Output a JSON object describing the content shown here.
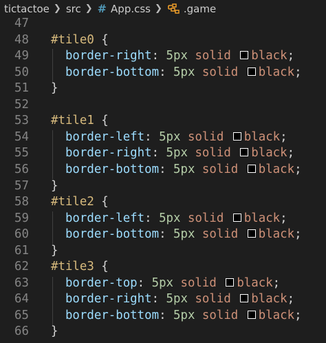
{
  "breadcrumb": {
    "folder1": "tictactoe",
    "folder2": "src",
    "file_icon": "#",
    "file": "App.css",
    "symbol": ".game"
  },
  "colors": {
    "black_swatch": "#000000"
  },
  "lines": [
    {
      "num": "47",
      "tokens": []
    },
    {
      "num": "48",
      "tokens": [
        {
          "t": "#tile0",
          "c": "sel"
        },
        {
          "t": " {",
          "c": "punc"
        }
      ]
    },
    {
      "num": "49",
      "tokens": [
        {
          "t": "  border-right",
          "c": "prop"
        },
        {
          "t": ": ",
          "c": "punc"
        },
        {
          "t": "5px",
          "c": "num"
        },
        {
          "t": " solid ",
          "c": "val"
        },
        {
          "sw": true
        },
        {
          "t": "black",
          "c": "val"
        },
        {
          "t": ";",
          "c": "punc"
        }
      ]
    },
    {
      "num": "50",
      "tokens": [
        {
          "t": "  border-bottom",
          "c": "prop"
        },
        {
          "t": ": ",
          "c": "punc"
        },
        {
          "t": "5px",
          "c": "num"
        },
        {
          "t": " solid ",
          "c": "val"
        },
        {
          "sw": true
        },
        {
          "t": "black",
          "c": "val"
        },
        {
          "t": ";",
          "c": "punc"
        }
      ]
    },
    {
      "num": "51",
      "tokens": [
        {
          "t": "}",
          "c": "punc"
        }
      ]
    },
    {
      "num": "52",
      "tokens": []
    },
    {
      "num": "53",
      "tokens": [
        {
          "t": "#tile1",
          "c": "sel"
        },
        {
          "t": " {",
          "c": "punc"
        }
      ]
    },
    {
      "num": "54",
      "tokens": [
        {
          "t": "  border-left",
          "c": "prop"
        },
        {
          "t": ": ",
          "c": "punc"
        },
        {
          "t": "5px",
          "c": "num"
        },
        {
          "t": " solid ",
          "c": "val"
        },
        {
          "sw": true
        },
        {
          "t": "black",
          "c": "val"
        },
        {
          "t": ";",
          "c": "punc"
        }
      ]
    },
    {
      "num": "55",
      "tokens": [
        {
          "t": "  border-right",
          "c": "prop"
        },
        {
          "t": ": ",
          "c": "punc"
        },
        {
          "t": "5px",
          "c": "num"
        },
        {
          "t": " solid ",
          "c": "val"
        },
        {
          "sw": true
        },
        {
          "t": "black",
          "c": "val"
        },
        {
          "t": ";",
          "c": "punc"
        }
      ]
    },
    {
      "num": "56",
      "tokens": [
        {
          "t": "  border-bottom",
          "c": "prop"
        },
        {
          "t": ": ",
          "c": "punc"
        },
        {
          "t": "5px",
          "c": "num"
        },
        {
          "t": " solid ",
          "c": "val"
        },
        {
          "sw": true
        },
        {
          "t": "black",
          "c": "val"
        },
        {
          "t": ";",
          "c": "punc"
        }
      ]
    },
    {
      "num": "57",
      "tokens": [
        {
          "t": "}",
          "c": "punc"
        }
      ]
    },
    {
      "num": "58",
      "tokens": [
        {
          "t": "#tile2",
          "c": "sel"
        },
        {
          "t": " {",
          "c": "punc"
        }
      ]
    },
    {
      "num": "59",
      "tokens": [
        {
          "t": "  border-left",
          "c": "prop"
        },
        {
          "t": ": ",
          "c": "punc"
        },
        {
          "t": "5px",
          "c": "num"
        },
        {
          "t": " solid ",
          "c": "val"
        },
        {
          "sw": true
        },
        {
          "t": "black",
          "c": "val"
        },
        {
          "t": ";",
          "c": "punc"
        }
      ]
    },
    {
      "num": "60",
      "tokens": [
        {
          "t": "  border-bottom",
          "c": "prop"
        },
        {
          "t": ": ",
          "c": "punc"
        },
        {
          "t": "5px",
          "c": "num"
        },
        {
          "t": " solid ",
          "c": "val"
        },
        {
          "sw": true
        },
        {
          "t": "black",
          "c": "val"
        },
        {
          "t": ";",
          "c": "punc"
        }
      ]
    },
    {
      "num": "61",
      "tokens": [
        {
          "t": "}",
          "c": "punc"
        }
      ]
    },
    {
      "num": "62",
      "tokens": [
        {
          "t": "#tile3",
          "c": "sel"
        },
        {
          "t": " {",
          "c": "punc"
        }
      ]
    },
    {
      "num": "63",
      "tokens": [
        {
          "t": "  border-top",
          "c": "prop"
        },
        {
          "t": ": ",
          "c": "punc"
        },
        {
          "t": "5px",
          "c": "num"
        },
        {
          "t": " solid ",
          "c": "val"
        },
        {
          "sw": true
        },
        {
          "t": "black",
          "c": "val"
        },
        {
          "t": ";",
          "c": "punc"
        }
      ]
    },
    {
      "num": "64",
      "tokens": [
        {
          "t": "  border-right",
          "c": "prop"
        },
        {
          "t": ": ",
          "c": "punc"
        },
        {
          "t": "5px",
          "c": "num"
        },
        {
          "t": " solid ",
          "c": "val"
        },
        {
          "sw": true
        },
        {
          "t": "black",
          "c": "val"
        },
        {
          "t": ";",
          "c": "punc"
        }
      ]
    },
    {
      "num": "65",
      "tokens": [
        {
          "t": "  border-bottom",
          "c": "prop"
        },
        {
          "t": ": ",
          "c": "punc"
        },
        {
          "t": "5px",
          "c": "num"
        },
        {
          "t": " solid ",
          "c": "val"
        },
        {
          "sw": true
        },
        {
          "t": "black",
          "c": "val"
        },
        {
          "t": ";",
          "c": "punc"
        }
      ]
    },
    {
      "num": "66",
      "tokens": [
        {
          "t": "}",
          "c": "punc"
        }
      ]
    }
  ]
}
